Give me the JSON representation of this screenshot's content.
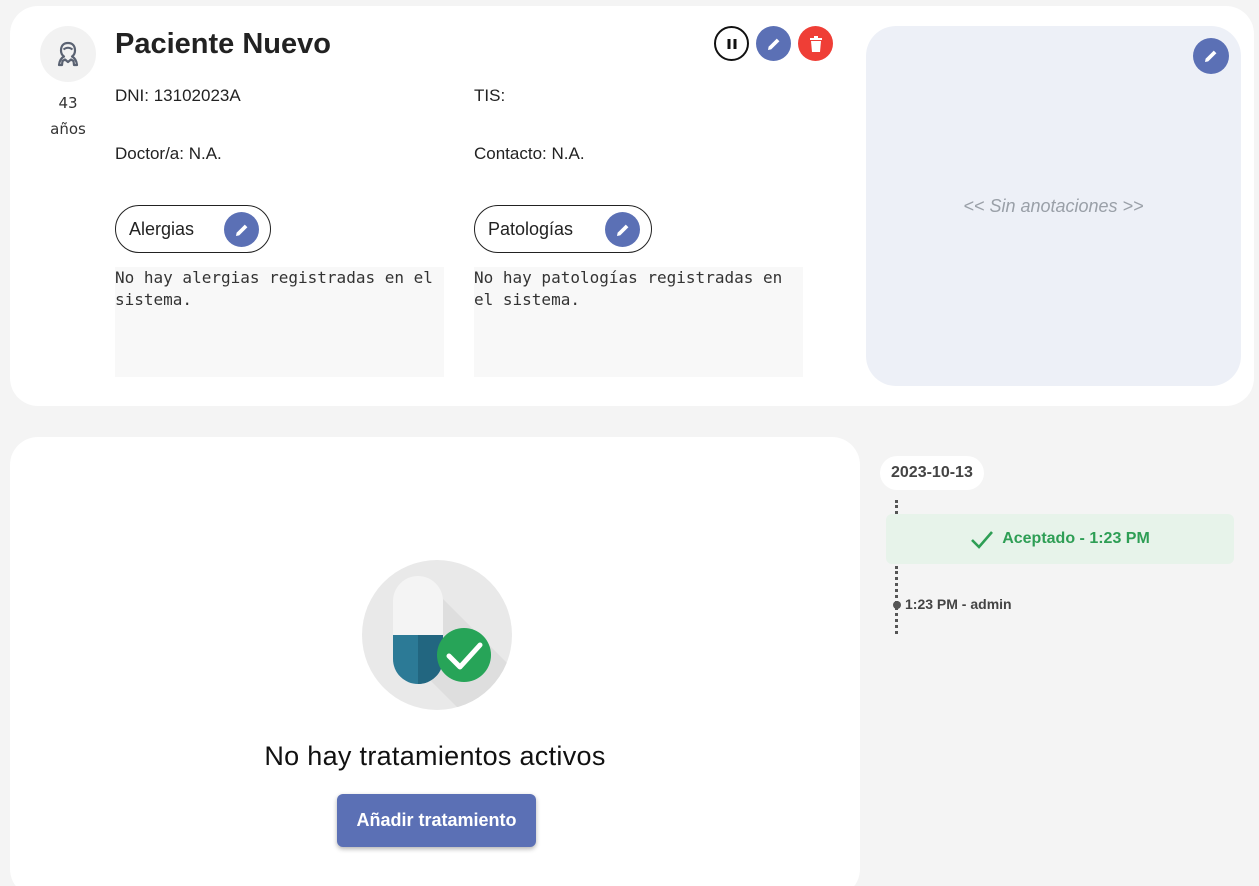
{
  "patient": {
    "name": "Paciente Nuevo",
    "age_value": "43",
    "age_unit": "años",
    "avatar_icon": "user-icon",
    "dni": "DNI: 13102023A",
    "tis": "TIS:",
    "doctor": "Doctor/a: N.A.",
    "contact": "Contacto: N.A."
  },
  "actions": {
    "pause_icon": "pause-icon",
    "edit_icon": "pencil-icon",
    "delete_icon": "trash-icon"
  },
  "allergies": {
    "label": "Alergias",
    "text": "No hay alergias registradas en el sistema."
  },
  "pathologies": {
    "label": "Patologías",
    "text": "No hay patologías registradas en el sistema."
  },
  "notes": {
    "empty_text": "<< Sin anotaciones >>"
  },
  "treatments": {
    "empty_text": "No hay tratamientos activos",
    "add_button": "Añadir tratamiento",
    "illustration_icon": "pill-check-icon"
  },
  "timeline": {
    "date": "2023-10-13",
    "status": "Aceptado - 1:23 PM",
    "status_icon": "check-icon",
    "entry": "1:23 PM - admin"
  },
  "colors": {
    "accent": "#5b70b5",
    "danger": "#ef3e36",
    "success": "#2e9e55",
    "success_bg": "#e7f3ea",
    "notes_bg": "#edf0f7"
  }
}
